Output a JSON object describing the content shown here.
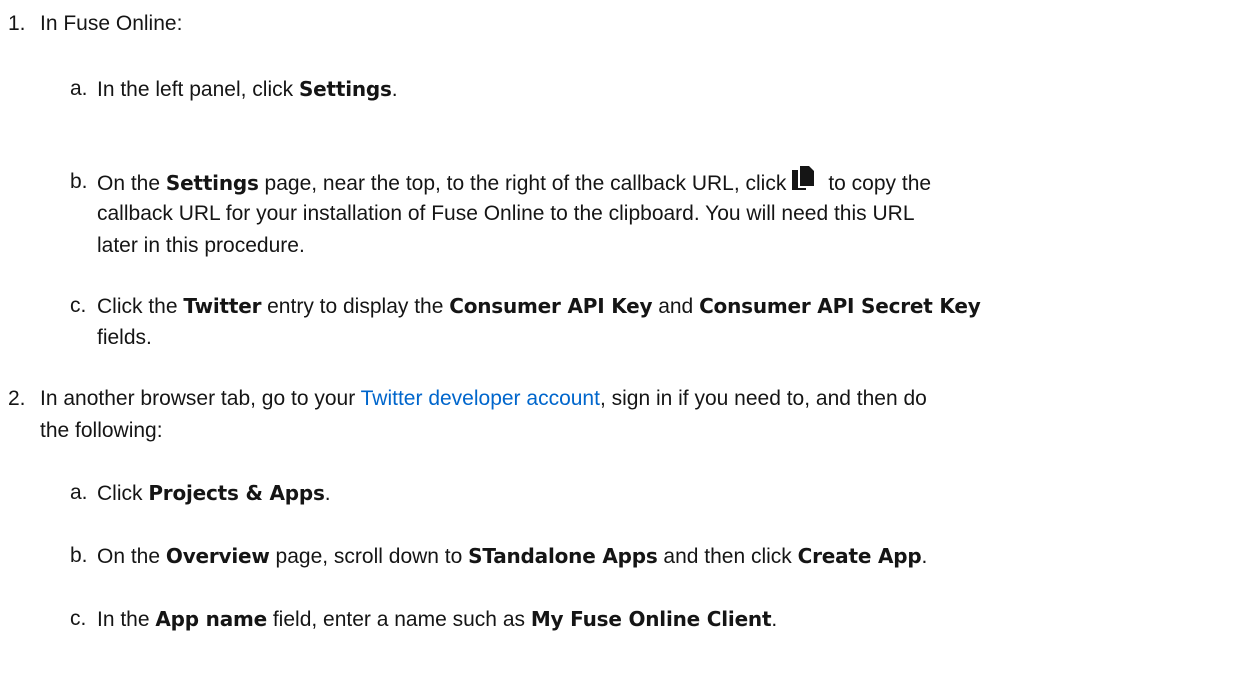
{
  "steps": [
    {
      "number": "1.",
      "text": "In Fuse Online:",
      "substeps": [
        {
          "letter": "a.",
          "t1": "In the left panel, click ",
          "b1": "Settings",
          "t2": "."
        },
        {
          "letter": "b.",
          "t1": "On the ",
          "b1": "Settings",
          "t2": " page, near the top, to the right of the callback URL, click",
          "icon": "copy-icon",
          "t3": "to copy the",
          "line2": "callback URL for your installation of Fuse Online to the clipboard. You will need this URL",
          "line3": "later in this procedure."
        },
        {
          "letter": "c.",
          "t1": "Click the ",
          "b1": "Twitter",
          "t2": " entry to display the ",
          "b2": "Consumer API Key",
          "t3": " and ",
          "b3": "Consumer API Secret Key",
          "line2": "fields."
        }
      ]
    },
    {
      "number": "2.",
      "t1": "In another browser tab, go to your ",
      "link": "Twitter developer account",
      "t2": ", sign in if you need to, and then do",
      "line2": "the following:",
      "substeps": [
        {
          "letter": "a.",
          "t1": "Click ",
          "b1": "Projects & Apps",
          "t2": "."
        },
        {
          "letter": "b.",
          "t1": "On the ",
          "b1": "Overview",
          "t2": " page, scroll down to ",
          "b2": "STandalone Apps",
          "t3": " and then click ",
          "b3": "Create App",
          "t4": "."
        },
        {
          "letter": "c.",
          "t1": "In the ",
          "b1": "App name",
          "t2": " field, enter a name such as ",
          "b2": "My Fuse Online Client",
          "t3": "."
        }
      ]
    }
  ],
  "colors": {
    "text": "#151515",
    "link": "#0066cc"
  }
}
